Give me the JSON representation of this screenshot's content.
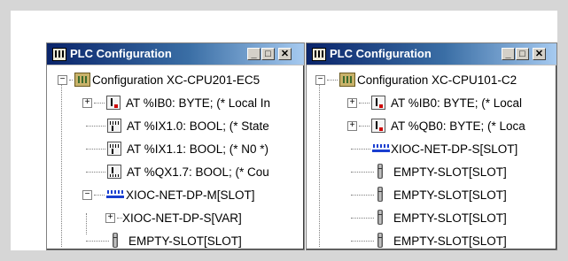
{
  "windows": [
    {
      "title": "PLC Configuration",
      "buttons": {
        "minimize": "_",
        "maximize": "□",
        "close": "✕"
      },
      "icon": "plc-config-icon",
      "nodes": [
        {
          "label": "Configuration XC-CPU201-EC5",
          "icon": "config-icon",
          "expander": "−"
        },
        {
          "label": "AT %IB0: BYTE; (* Local In",
          "icon": "input-byte-icon",
          "expander": "+"
        },
        {
          "label": "AT %IX1.0: BOOL; (* State",
          "icon": "input-bit-icon"
        },
        {
          "label": "AT %IX1.1: BOOL; (* N0 *)",
          "icon": "input-bit-icon"
        },
        {
          "label": "AT %QX1.7: BOOL; (* Cou",
          "icon": "output-bit-icon"
        },
        {
          "label": "XIOC-NET-DP-M[SLOT]",
          "icon": "network-module-icon",
          "expander": "−"
        },
        {
          "label": "XIOC-NET-DP-S[VAR]",
          "expander": "+"
        },
        {
          "label": "EMPTY-SLOT[SLOT]",
          "icon": "empty-slot-icon"
        }
      ]
    },
    {
      "title": "PLC Configuration",
      "buttons": {
        "minimize": "_",
        "maximize": "□",
        "close": "✕"
      },
      "icon": "plc-config-icon",
      "nodes": [
        {
          "label": "Configuration XC-CPU101-C2",
          "icon": "config-icon",
          "expander": "−"
        },
        {
          "label": "AT %IB0: BYTE; (* Local",
          "icon": "input-byte-icon",
          "expander": "+"
        },
        {
          "label": "AT %QB0: BYTE; (* Loca",
          "icon": "output-byte-icon",
          "expander": "+"
        },
        {
          "label": "XIOC-NET-DP-S[SLOT]",
          "icon": "network-module-icon"
        },
        {
          "label": "EMPTY-SLOT[SLOT]",
          "icon": "empty-slot-icon"
        },
        {
          "label": "EMPTY-SLOT[SLOT]",
          "icon": "empty-slot-icon"
        },
        {
          "label": "EMPTY-SLOT[SLOT]",
          "icon": "empty-slot-icon"
        },
        {
          "label": "EMPTY-SLOT[SLOT]",
          "icon": "empty-slot-icon"
        }
      ]
    }
  ],
  "colors": {
    "titlebar_start": "#0a246a",
    "titlebar_end": "#a6caf0",
    "network_icon": "#1a3fd0",
    "frame_bg": "#d6d6d6"
  }
}
